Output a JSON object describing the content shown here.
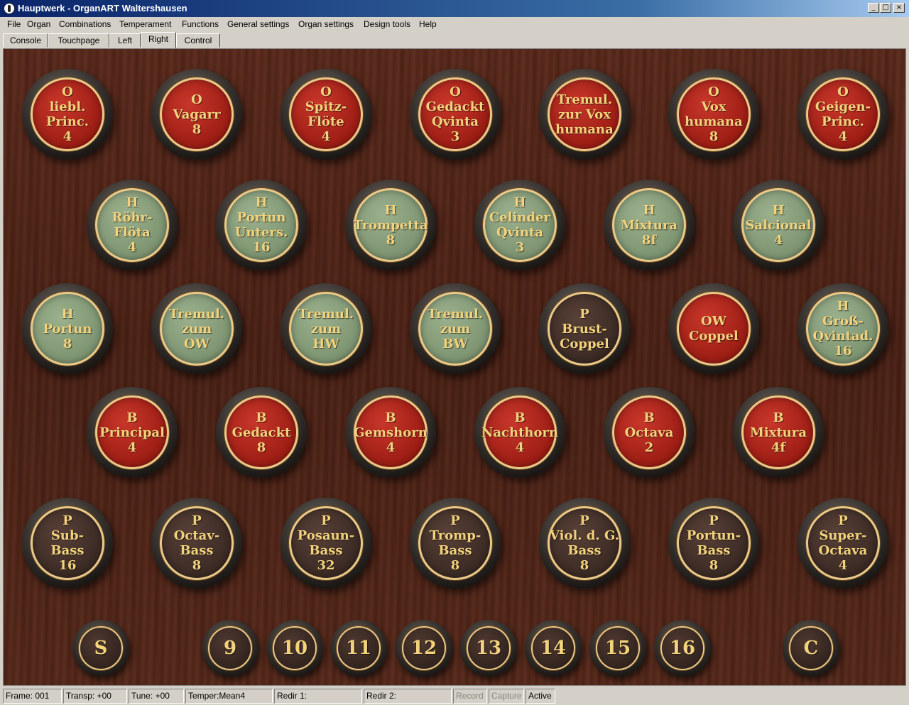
{
  "window": {
    "title": "Hauptwerk - OrganART Waltershausen",
    "minimize": "_",
    "maximize": "□",
    "close": "×"
  },
  "menu": [
    "File",
    "Organ",
    "Combinations",
    "Temperament",
    "Functions",
    "General settings",
    "Organ settings",
    "Design tools",
    "Help"
  ],
  "tabs": {
    "items": [
      "Console",
      "Touchpage",
      "Left",
      "Right",
      "Control"
    ],
    "active": "Right"
  },
  "stops": {
    "row1": [
      {
        "color": "red",
        "lines": [
          "O",
          "liebl.",
          "Princ.",
          "4"
        ]
      },
      {
        "color": "red",
        "lines": [
          "O",
          "Vagarr",
          "8"
        ]
      },
      {
        "color": "red",
        "lines": [
          "O",
          "Spitz-",
          "Flöte",
          "4"
        ]
      },
      {
        "color": "red",
        "lines": [
          "O",
          "Gedackt",
          "Qvinta",
          "3"
        ]
      },
      {
        "color": "red",
        "lines": [
          "Tremul.",
          "zur Vox",
          "humana"
        ]
      },
      {
        "color": "red",
        "lines": [
          "O",
          "Vox",
          "humana",
          "8"
        ]
      },
      {
        "color": "red",
        "lines": [
          "O",
          "Geigen-",
          "Princ.",
          "4"
        ]
      }
    ],
    "row2": [
      {
        "color": "green",
        "lines": [
          "H",
          "Röhr-",
          "Flöta",
          "4"
        ]
      },
      {
        "color": "green",
        "lines": [
          "H",
          "Portun",
          "Unters.",
          "16"
        ]
      },
      {
        "color": "green",
        "lines": [
          "H",
          "Trompetta",
          "8"
        ]
      },
      {
        "color": "green",
        "lines": [
          "H",
          "Celinder",
          "Qvinta",
          "3"
        ]
      },
      {
        "color": "green",
        "lines": [
          "H",
          "Mixtura",
          "8f"
        ]
      },
      {
        "color": "green",
        "lines": [
          "H",
          "Salcional",
          "4"
        ]
      }
    ],
    "row3": [
      {
        "color": "green",
        "lines": [
          "H",
          "Portun",
          "8"
        ]
      },
      {
        "color": "green",
        "lines": [
          "Tremul.",
          "zum",
          "OW"
        ]
      },
      {
        "color": "green",
        "lines": [
          "Tremul.",
          "zum",
          "HW"
        ]
      },
      {
        "color": "green",
        "lines": [
          "Tremul.",
          "zum",
          "BW"
        ]
      },
      {
        "color": "brown",
        "lines": [
          "P",
          "Brust-",
          "Coppel"
        ]
      },
      {
        "color": "red",
        "lines": [
          "OW",
          "Coppel"
        ]
      },
      {
        "color": "green",
        "lines": [
          "H",
          "Groß-",
          "Qvintad.",
          "16"
        ]
      }
    ],
    "row4": [
      {
        "color": "red",
        "lines": [
          "B",
          "Principal",
          "4"
        ]
      },
      {
        "color": "red",
        "lines": [
          "B",
          "Gedackt",
          "8"
        ]
      },
      {
        "color": "red",
        "lines": [
          "B",
          "Gemshorn",
          "4"
        ]
      },
      {
        "color": "red",
        "lines": [
          "B",
          "Nachthorn",
          "4"
        ]
      },
      {
        "color": "red",
        "lines": [
          "B",
          "Octava",
          "2"
        ]
      },
      {
        "color": "red",
        "lines": [
          "B",
          "Mixtura",
          "4f"
        ]
      }
    ],
    "row5": [
      {
        "color": "brown",
        "lines": [
          "P",
          "Sub-",
          "Bass",
          "16"
        ]
      },
      {
        "color": "brown",
        "lines": [
          "P",
          "Octav-",
          "Bass",
          "8"
        ]
      },
      {
        "color": "brown",
        "lines": [
          "P",
          "Posaun-",
          "Bass",
          "32"
        ]
      },
      {
        "color": "brown",
        "lines": [
          "P",
          "Tromp-",
          "Bass",
          "8"
        ]
      },
      {
        "color": "brown",
        "lines": [
          "P",
          "Viol. d. G.",
          "Bass",
          "8"
        ]
      },
      {
        "color": "brown",
        "lines": [
          "P",
          "Portun-",
          "Bass",
          "8"
        ]
      },
      {
        "color": "brown",
        "lines": [
          "P",
          "Super-",
          "Octava",
          "4"
        ]
      }
    ]
  },
  "pistons": [
    "S",
    "9",
    "10",
    "11",
    "12",
    "13",
    "14",
    "15",
    "16",
    "C"
  ],
  "status": {
    "frame": "Frame: 001",
    "transp": "Transp: +00",
    "tune": "Tune: +00",
    "temper": "Temper:Mean4",
    "redir1": "Redir 1:",
    "redir2": "Redir 2:",
    "record": "Record",
    "capture": "Capture",
    "active": "Active"
  }
}
